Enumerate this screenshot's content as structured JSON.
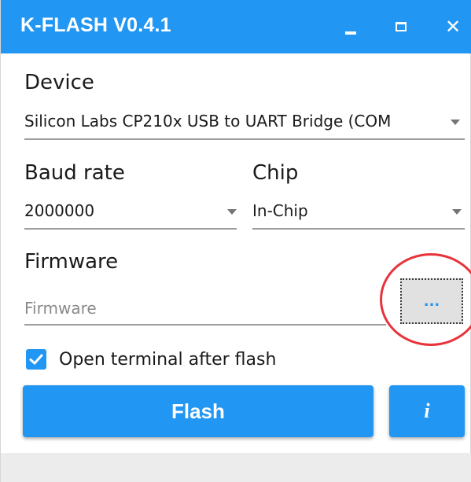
{
  "window": {
    "title": "K-FLASH V0.4.1",
    "colors": {
      "accent": "#2196f3",
      "highlight": "#e8333b"
    },
    "controls": {
      "minimize_icon": "minimize-icon",
      "maximize_icon": "maximize-icon",
      "close_icon": "close-icon",
      "close_glyph": "✕"
    }
  },
  "device": {
    "label": "Device",
    "value": "Silicon Labs CP210x USB to UART Bridge (COM"
  },
  "baud_rate": {
    "label": "Baud rate",
    "value": "2000000"
  },
  "chip": {
    "label": "Chip",
    "value": "In-Chip"
  },
  "firmware": {
    "label": "Firmware",
    "placeholder": "Firmware",
    "value": "",
    "browse_label": "..."
  },
  "open_terminal": {
    "label": "Open terminal after flash",
    "checked": true
  },
  "actions": {
    "flash_label": "Flash",
    "info_label": "i"
  }
}
